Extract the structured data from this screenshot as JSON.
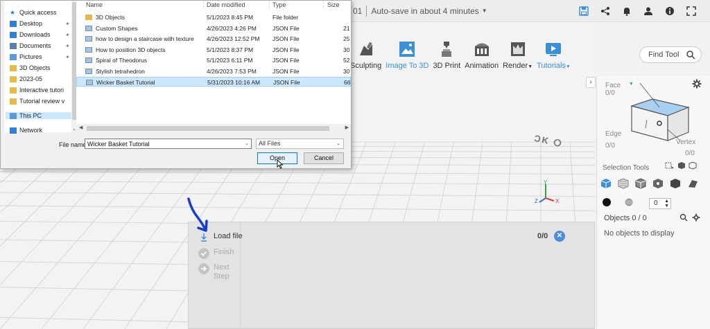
{
  "topbar": {
    "doc_suffix": "01",
    "autosave": "Auto-save in about 4 minutes",
    "icons": [
      "save-icon",
      "share-icon",
      "bell-icon",
      "user-icon",
      "info-icon",
      "fullscreen-icon"
    ]
  },
  "toolbar": {
    "tools": [
      {
        "label": "Sculpting",
        "icon": "sculpting-icon"
      },
      {
        "label": "Image To 3D",
        "icon": "image-to-3d-icon"
      },
      {
        "label": "3D Print",
        "icon": "printer-3d-icon"
      },
      {
        "label": "Animation",
        "icon": "animation-icon"
      },
      {
        "label": "Render",
        "icon": "render-icon"
      },
      {
        "label": "Tutorials",
        "icon": "tutorials-icon"
      }
    ],
    "find_tool": "Find Tool"
  },
  "right_panel": {
    "face_label": "Face",
    "face_value": "0/0",
    "edge_label": "Edge",
    "edge_value": "0/0",
    "vertex_label": "Vertex",
    "vertex_value": "0/0",
    "selection_tools_label": "Selection Tools",
    "stepper_value": "0",
    "objects_header": "Objects 0 / 0",
    "no_objects": "No objects to display",
    "accent_color": "#4a90d9"
  },
  "load_panel": {
    "steps": [
      {
        "label": "Load file",
        "active": true
      },
      {
        "label": "Finish",
        "active": false
      },
      {
        "label": "Next Step",
        "active": false
      }
    ],
    "count": "0/0"
  },
  "viewport_text": "ƆK ⵔ",
  "axis": {
    "x": "X",
    "y": "Y",
    "z": "Z"
  },
  "file_dialog": {
    "nav_items": [
      {
        "label": "Quick access",
        "icon": "star-icon",
        "pinned": false
      },
      {
        "label": "Desktop",
        "icon": "desktop-icon",
        "pinned": true
      },
      {
        "label": "Downloads",
        "icon": "download-icon",
        "pinned": true
      },
      {
        "label": "Documents",
        "icon": "documents-icon",
        "pinned": true
      },
      {
        "label": "Pictures",
        "icon": "pictures-icon",
        "pinned": true
      },
      {
        "label": "3D Objects",
        "icon": "folder-icon",
        "pinned": false
      },
      {
        "label": "2023-05",
        "icon": "folder-icon",
        "pinned": false
      },
      {
        "label": "Interactive tutori",
        "icon": "folder-icon",
        "pinned": false
      },
      {
        "label": "Tutorial review v",
        "icon": "folder-icon",
        "pinned": false
      },
      {
        "label": "This PC",
        "icon": "pc-icon",
        "pinned": false
      },
      {
        "label": "Network",
        "icon": "network-icon",
        "pinned": false
      }
    ],
    "columns": [
      "Name",
      "Date modified",
      "Type",
      "Size"
    ],
    "files": [
      {
        "name": "3D Objects",
        "date": "5/1/2023 8:45 PM",
        "type": "File folder",
        "size": "",
        "icon": "folder-icon"
      },
      {
        "name": "Custom Shapes",
        "date": "4/26/2023 4:26 PM",
        "type": "JSON File",
        "size": "21",
        "icon": "json-file-icon"
      },
      {
        "name": "how to design a staircase with texture",
        "date": "4/26/2023 12:52 PM",
        "type": "JSON File",
        "size": "25",
        "icon": "json-file-icon"
      },
      {
        "name": "How to position 3D objects",
        "date": "5/1/2023 8:37 PM",
        "type": "JSON File",
        "size": "30",
        "icon": "json-file-icon"
      },
      {
        "name": "Spiral of Theodorus",
        "date": "5/1/2023 6:11 PM",
        "type": "JSON File",
        "size": "52",
        "icon": "json-file-icon"
      },
      {
        "name": "Stylish tetrahedron",
        "date": "4/26/2023 7:53 PM",
        "type": "JSON File",
        "size": "30",
        "icon": "json-file-icon"
      },
      {
        "name": "Wicker Basket Tutorial",
        "date": "5/31/2023 10:16 AM",
        "type": "JSON File",
        "size": "66",
        "icon": "json-file-icon",
        "selected": true
      }
    ],
    "file_name_label": "File name:",
    "file_name_value": "Wicker Basket Tutorial",
    "file_type": "All Files",
    "open_label": "Open",
    "cancel_label": "Cancel"
  }
}
